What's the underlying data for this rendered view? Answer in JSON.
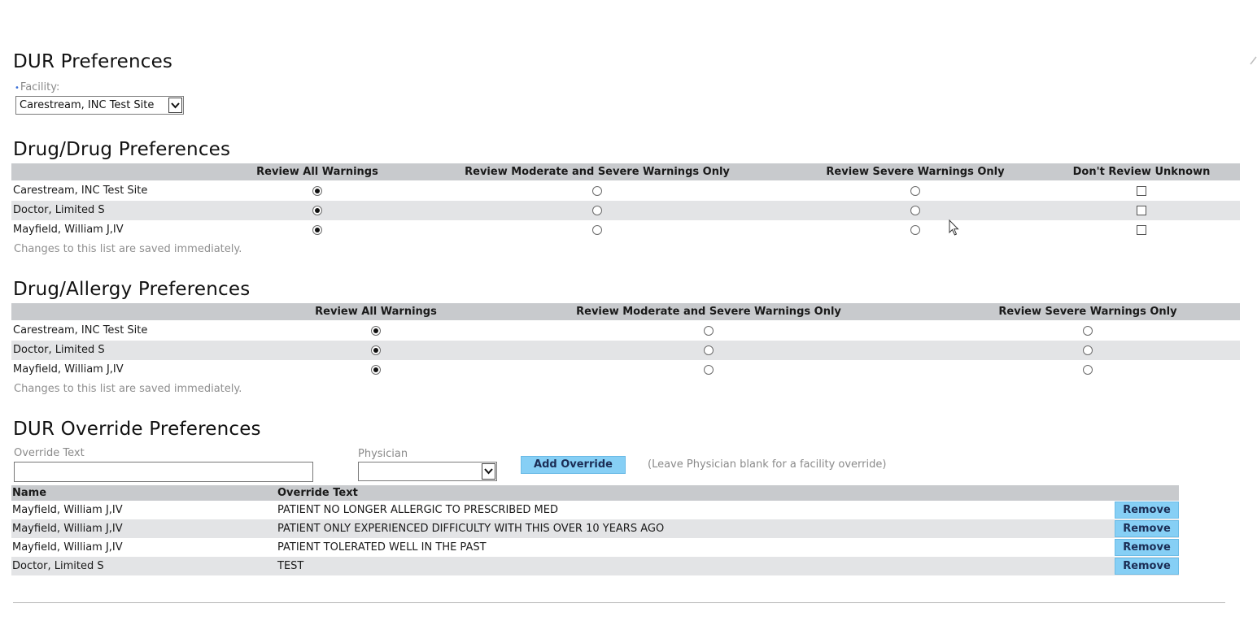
{
  "page": {
    "title": "DUR Preferences",
    "facility_label": "Facility:",
    "facility_value": "Carestream, INC Test Site"
  },
  "drug_drug": {
    "title": "Drug/Drug Preferences",
    "columns": [
      "Review All Warnings",
      "Review Moderate and Severe Warnings Only",
      "Review Severe Warnings Only",
      "Don't Review Unknown"
    ],
    "rows": [
      {
        "name": "Carestream, INC Test Site",
        "selected": 0,
        "dont_review_unknown": false
      },
      {
        "name": "Doctor, Limited S",
        "selected": 0,
        "dont_review_unknown": false
      },
      {
        "name": "Mayfield, William J,IV",
        "selected": 0,
        "dont_review_unknown": false
      }
    ],
    "note": "Changes to this list are saved immediately."
  },
  "drug_allergy": {
    "title": "Drug/Allergy Preferences",
    "columns": [
      "Review All Warnings",
      "Review Moderate and Severe Warnings Only",
      "Review Severe Warnings Only"
    ],
    "rows": [
      {
        "name": "Carestream, INC Test Site",
        "selected": 0
      },
      {
        "name": "Doctor, Limited S",
        "selected": 0
      },
      {
        "name": "Mayfield, William J,IV",
        "selected": 0
      }
    ],
    "note": "Changes to this list are saved immediately."
  },
  "override": {
    "title": "DUR Override Preferences",
    "override_text_label": "Override Text",
    "override_text_value": "",
    "physician_label": "Physician",
    "physician_value": "",
    "add_button": "Add Override",
    "hint": "(Leave Physician blank for a facility override)",
    "col_name": "Name",
    "col_text": "Override Text",
    "remove_label": "Remove",
    "rows": [
      {
        "name": "Mayfield, William J,IV",
        "text": "PATIENT NO LONGER ALLERGIC TO PRESCRIBED MED"
      },
      {
        "name": "Mayfield, William J,IV",
        "text": "PATIENT ONLY EXPERIENCED DIFFICULTY WITH THIS OVER 10 YEARS AGO"
      },
      {
        "name": "Mayfield, William J,IV",
        "text": "PATIENT TOLERATED WELL IN THE PAST"
      },
      {
        "name": "Doctor, Limited S",
        "text": "TEST"
      }
    ]
  },
  "icons": {
    "dropdown": "chevron-down-icon",
    "cursor": "mouse-pointer-icon",
    "scroll": "scroll-up-icon"
  }
}
